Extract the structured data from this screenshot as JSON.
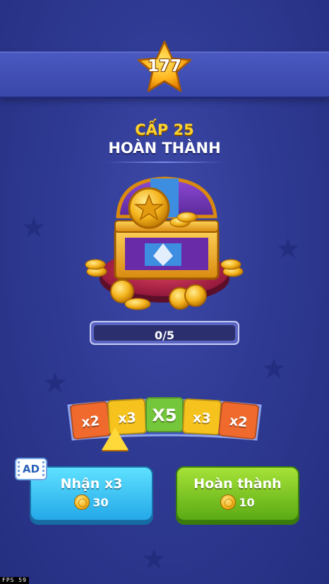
{
  "header": {
    "star_count": "177"
  },
  "level": {
    "label": "CẤP 25",
    "subtitle": "HOÀN THÀNH"
  },
  "progress": {
    "text": "0/5",
    "current": 0,
    "total": 5
  },
  "multipliers": [
    {
      "label": "x2",
      "color": "#f06a2e"
    },
    {
      "label": "x3",
      "color": "#f6c21d"
    },
    {
      "label": "X5",
      "color": "#74c63a"
    },
    {
      "label": "x3",
      "color": "#f6c21d"
    },
    {
      "label": "x2",
      "color": "#f06a2e"
    }
  ],
  "buttons": {
    "ad_badge": "AD",
    "claim": {
      "label": "Nhận x3",
      "cost": "30"
    },
    "complete": {
      "label": "Hoàn thành",
      "cost": "10"
    }
  },
  "fps": {
    "label": "FPS",
    "value": "59"
  },
  "colors": {
    "background": "#2f3a93",
    "claim_button": "#24a8e8",
    "complete_button": "#5aaa14",
    "level_text": "#ffd22e"
  }
}
